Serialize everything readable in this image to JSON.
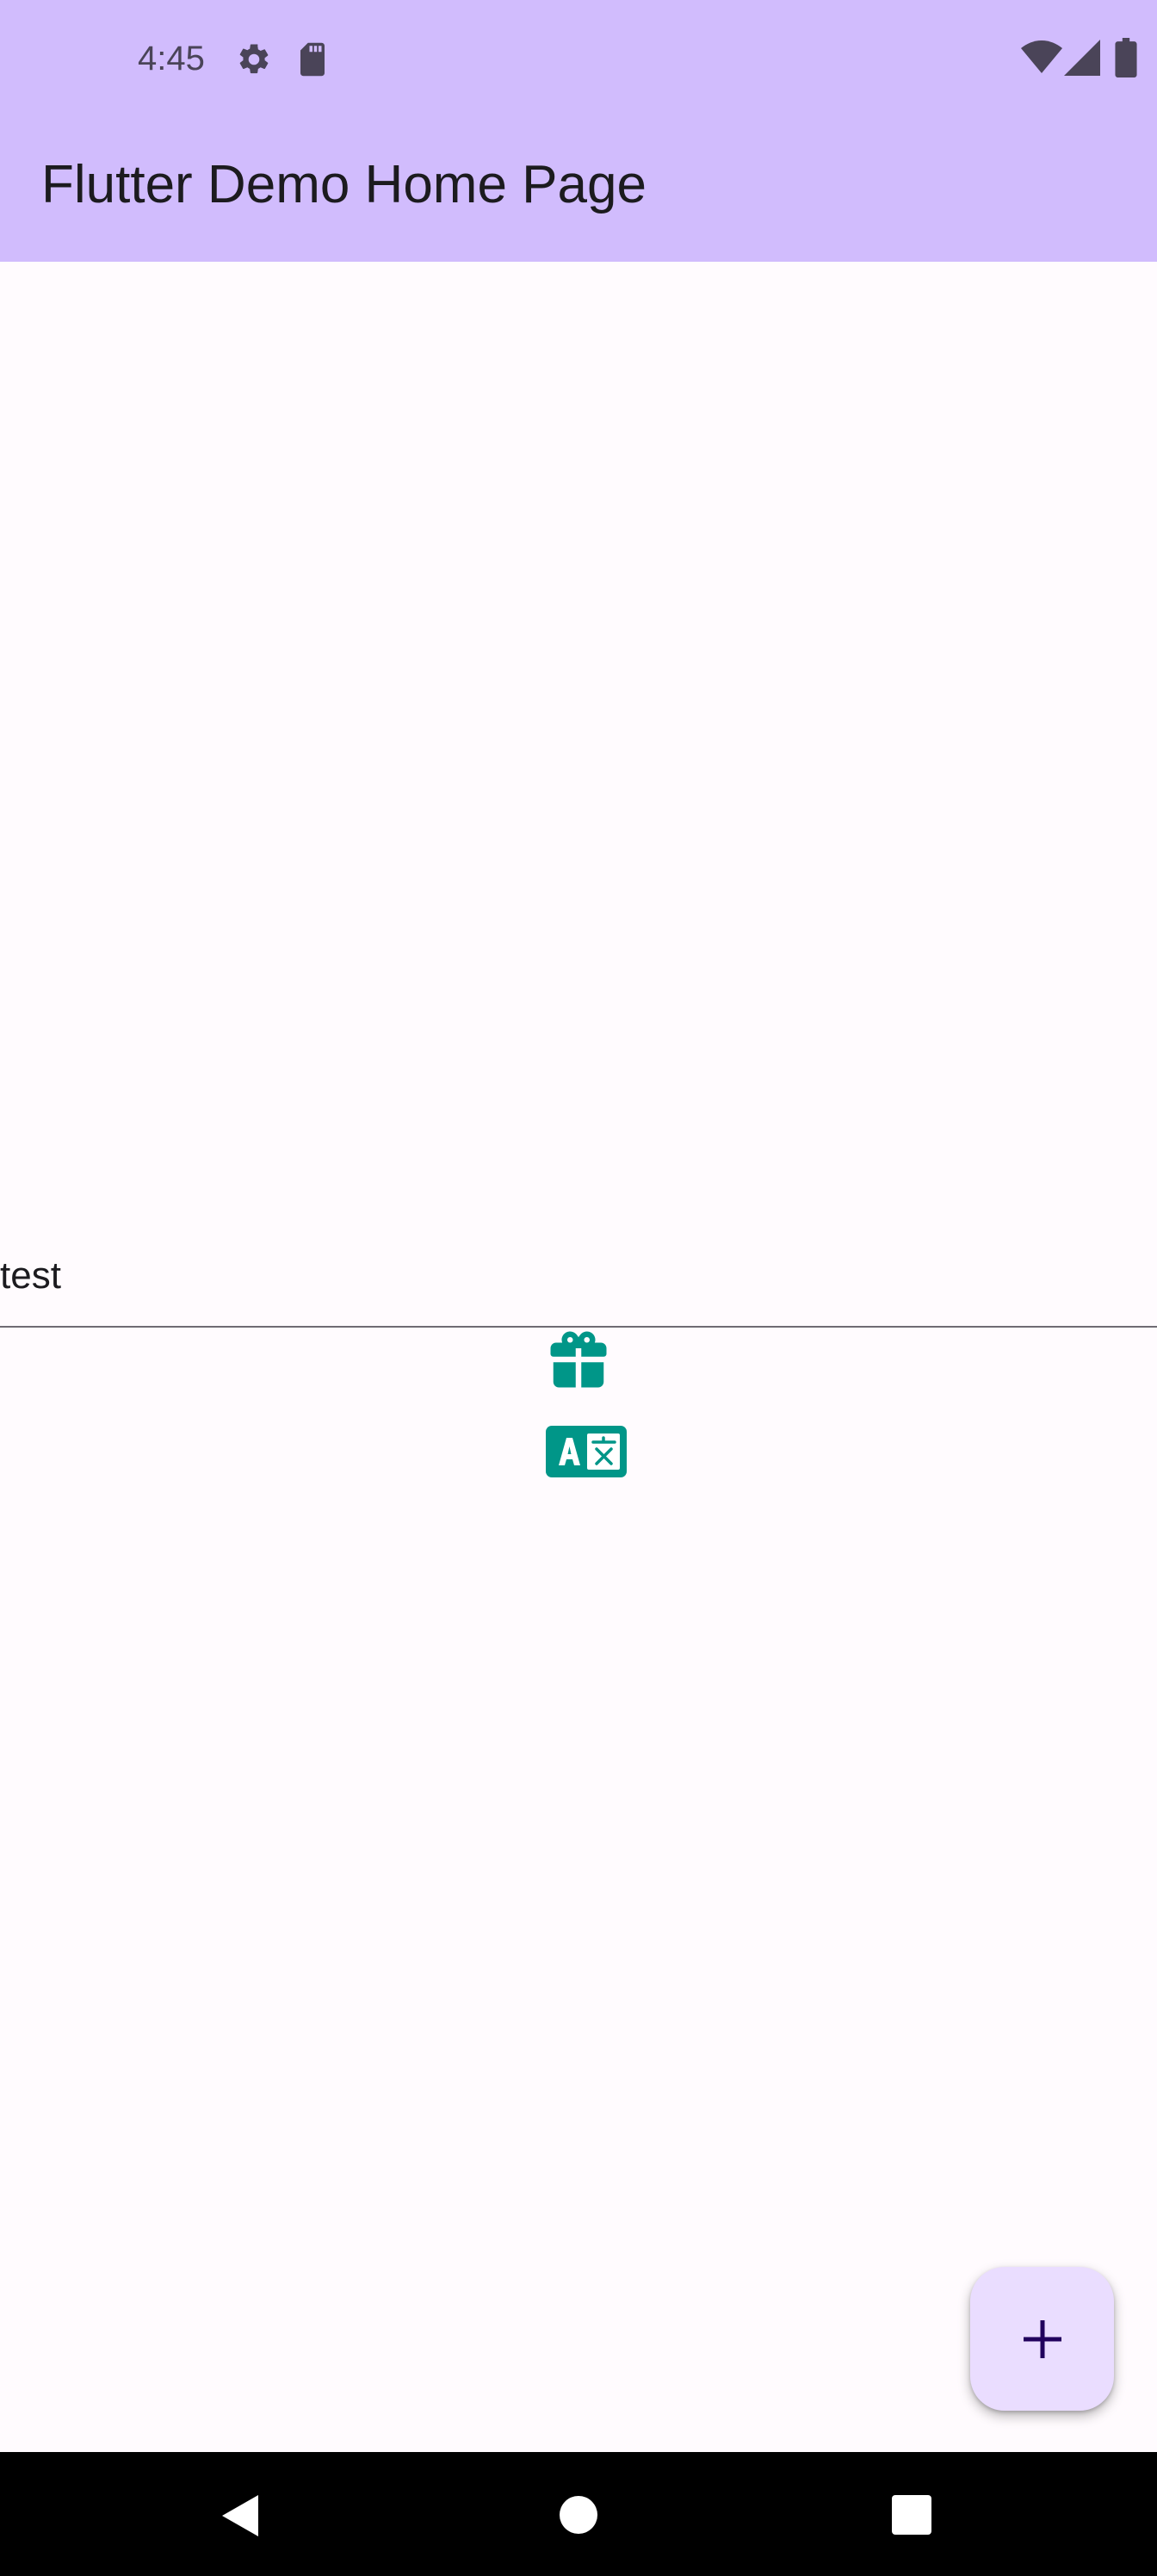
{
  "status_bar": {
    "time": "4:45",
    "icons": [
      "gear-icon",
      "sd-card-icon",
      "wifi-icon",
      "cell-signal-icon",
      "battery-icon"
    ]
  },
  "app_bar": {
    "title": "Flutter Demo Home Page"
  },
  "main": {
    "text_field_value": "test",
    "icons": [
      "gift-icon",
      "translate-icon"
    ]
  },
  "fab": {
    "icon": "plus-icon"
  },
  "nav_bar": {
    "buttons": [
      "back-icon",
      "home-icon",
      "recents-icon"
    ]
  },
  "colors": {
    "app_bar_background": "#d1bcfd",
    "page_background": "#fffbfe",
    "accent_icon": "#009688",
    "fab_background": "#eaddff",
    "fab_icon": "#21005d",
    "text_primary": "#1c1b1f",
    "status_icon": "#4a4458"
  }
}
